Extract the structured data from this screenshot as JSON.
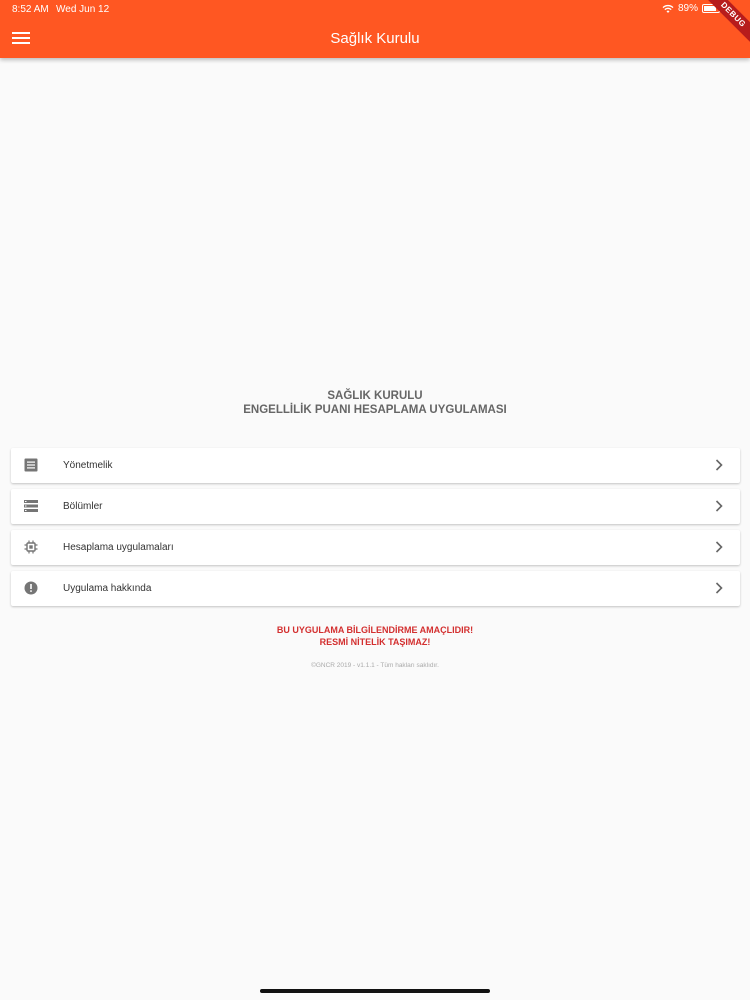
{
  "status_bar": {
    "time": "8:52 AM",
    "date": "Wed Jun 12",
    "battery": "89%"
  },
  "app_bar": {
    "title": "Sağlık Kurulu",
    "debug_banner": "DEBUG",
    "color": "#ff5722"
  },
  "heading": {
    "line1": "SAĞLIK KURULU",
    "line2": "ENGELLİLİK PUANI HESAPLAMA UYGULAMASI"
  },
  "menu": {
    "items": [
      {
        "label": "Yönetmelik",
        "icon": "document-icon"
      },
      {
        "label": "Bölümler",
        "icon": "list-icon"
      },
      {
        "label": "Hesaplama uygulamaları",
        "icon": "chip-icon"
      },
      {
        "label": "Uygulama hakkında",
        "icon": "info-icon"
      }
    ]
  },
  "warning": {
    "line1": "BU UYGULAMA BİLGİLENDİRME AMAÇLIDIR!",
    "line2": "RESMİ NİTELİK TAŞIMAZ!",
    "color": "#d32f2f"
  },
  "footer": {
    "text": "©GNCR 2019 - v1.1.1 - Tüm hakları saklıdır."
  }
}
